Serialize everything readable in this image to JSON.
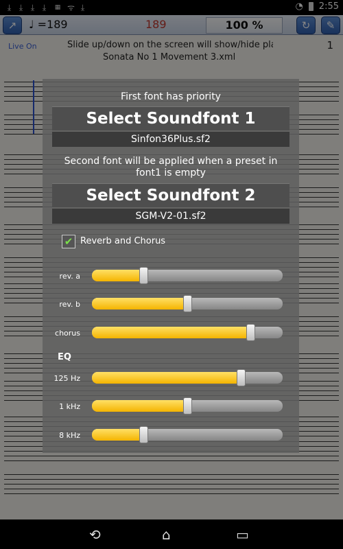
{
  "status": {
    "time": "2:55",
    "notifications": [
      "download",
      "download",
      "download",
      "download",
      "grid",
      "wifi-signal",
      "download"
    ]
  },
  "toolbar": {
    "tempo_label": "♩ =189",
    "tempo_value": "189",
    "zoom": "100 %"
  },
  "info": {
    "live_label": "Live On",
    "hint": "Slide up/down on the screen will show/hide play",
    "score_title": "Sonata No 1 Movement 3.xml",
    "page": "1"
  },
  "dialog": {
    "font1_note": "First font has priority",
    "font1_button": "Select Soundfont 1",
    "font1_file": "Sinfon36Plus.sf2",
    "font2_note": "Second font will be applied when a preset in font1 is empty",
    "font2_button": "Select Soundfont 2",
    "font2_file": "SGM-V2-01.sf2",
    "reverb_label": "Reverb and Chorus",
    "reverb_checked": true,
    "eq_label": "EQ",
    "sliders": [
      {
        "label": "rev. a",
        "value": 0.27
      },
      {
        "label": "rev. b",
        "value": 0.5
      },
      {
        "label": "chorus",
        "value": 0.83
      },
      {
        "label": "125 Hz",
        "value": 0.78
      },
      {
        "label": "1 kHz",
        "value": 0.5
      },
      {
        "label": "8 kHz",
        "value": 0.27
      }
    ]
  },
  "colors": {
    "accent": "#f4b400",
    "tempo": "#c0362c",
    "live": "#3a5fd4"
  }
}
